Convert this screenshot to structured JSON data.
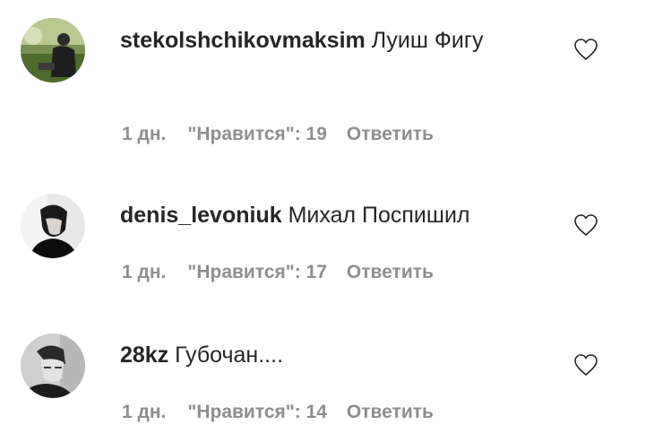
{
  "comments": [
    {
      "username": "stekolshchikovmaksim",
      "text": "Луиш Фигу",
      "time": "1 дн.",
      "likes": "\"Нравится\": 19",
      "reply": "Ответить"
    },
    {
      "username": "denis_levoniuk",
      "text": "Михал Поспишил",
      "time": "1 дн.",
      "likes": "\"Нравится\": 17",
      "reply": "Ответить"
    },
    {
      "username": "28kz",
      "text": "Губочан....",
      "time": "1 дн.",
      "likes": "\"Нравится\": 14",
      "reply": "Ответить"
    }
  ],
  "icons": {
    "like": "heart-outline-icon"
  },
  "colors": {
    "text": "#262626",
    "secondary": "#8e8e8e"
  }
}
